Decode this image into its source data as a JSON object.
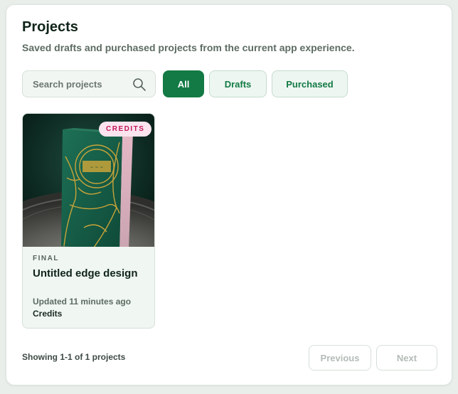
{
  "header": {
    "title": "Projects",
    "subtitle": "Saved drafts and purchased projects from the current app experience."
  },
  "search": {
    "placeholder": "Search projects",
    "value": "",
    "icon": "search-icon"
  },
  "filters": [
    {
      "label": "All",
      "active": true
    },
    {
      "label": "Drafts",
      "active": false
    },
    {
      "label": "Purchased",
      "active": false
    }
  ],
  "projects": [
    {
      "badge": "CREDITS",
      "status": "FINAL",
      "title": "Untitled edge design",
      "updated": "Updated 11 minutes ago",
      "type": "Credits",
      "thumbnail": "green-book-edge-design-image"
    }
  ],
  "pagination": {
    "summary": "Showing 1-1 of 1 projects",
    "previous_label": "Previous",
    "next_label": "Next",
    "previous_enabled": false,
    "next_enabled": false
  },
  "colors": {
    "accent": "#137a45",
    "badge_bg": "#fbe4ee",
    "badge_text": "#c2185b",
    "page_bg": "#e9eeea"
  }
}
